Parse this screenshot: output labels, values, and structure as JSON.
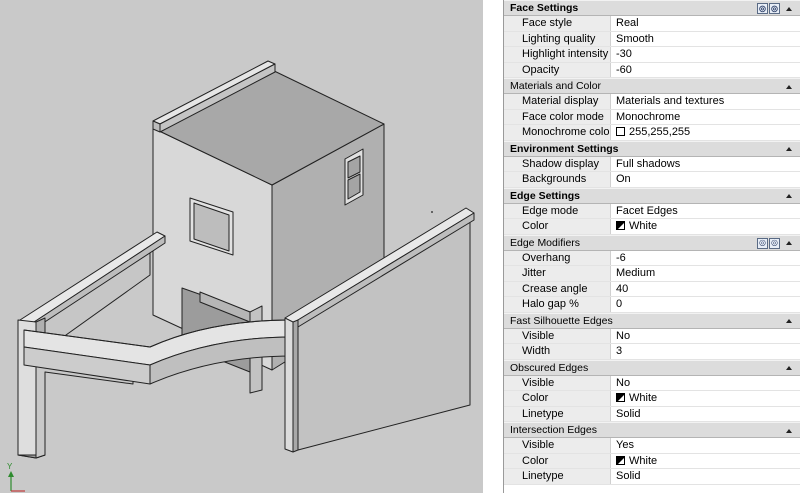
{
  "panel": {
    "sections": [
      {
        "title": "Face Settings",
        "bold": true,
        "buttons": true,
        "rows": [
          {
            "label": "Face style",
            "value": "Real"
          },
          {
            "label": "Lighting quality",
            "value": "Smooth"
          },
          {
            "label": "Highlight intensity",
            "value": "-30"
          },
          {
            "label": "Opacity",
            "value": "-60"
          }
        ]
      },
      {
        "title": "Materials and Color",
        "bold": false,
        "buttons": false,
        "rows": [
          {
            "label": "Material display",
            "value": "Materials and textures"
          },
          {
            "label": "Face color mode",
            "value": "Monochrome"
          },
          {
            "label": "Monochrome color",
            "value": "255,255,255",
            "swatch": "empty"
          }
        ]
      },
      {
        "title": "Environment Settings",
        "bold": true,
        "buttons": false,
        "rows": [
          {
            "label": "Shadow display",
            "value": "Full shadows"
          },
          {
            "label": "Backgrounds",
            "value": "On"
          }
        ]
      },
      {
        "title": "Edge Settings",
        "bold": true,
        "buttons": false,
        "rows": [
          {
            "label": "Edge mode",
            "value": "Facet Edges"
          },
          {
            "label": "Color",
            "value": "White",
            "swatch": "half"
          }
        ]
      },
      {
        "title": "Edge Modifiers",
        "bold": false,
        "buttons": true,
        "rows": [
          {
            "label": "Overhang",
            "value": "-6"
          },
          {
            "label": "Jitter",
            "value": "Medium"
          },
          {
            "label": "Crease angle",
            "value": "40"
          },
          {
            "label": "Halo gap %",
            "value": "0"
          }
        ]
      },
      {
        "title": "Fast Silhouette Edges",
        "bold": false,
        "buttons": false,
        "rows": [
          {
            "label": "Visible",
            "value": "No"
          },
          {
            "label": "Width",
            "value": "3"
          }
        ]
      },
      {
        "title": "Obscured Edges",
        "bold": false,
        "buttons": false,
        "rows": [
          {
            "label": "Visible",
            "value": "No"
          },
          {
            "label": "Color",
            "value": "White",
            "swatch": "half"
          },
          {
            "label": "Linetype",
            "value": "Solid"
          }
        ]
      },
      {
        "title": "Intersection Edges",
        "bold": false,
        "buttons": false,
        "rows": [
          {
            "label": "Visible",
            "value": "Yes"
          },
          {
            "label": "Color",
            "value": "White",
            "swatch": "half"
          },
          {
            "label": "Linetype",
            "value": "Solid"
          }
        ]
      }
    ]
  },
  "viewport": {
    "ucs_label": "Y",
    "background_color": "#c9c9c9"
  }
}
